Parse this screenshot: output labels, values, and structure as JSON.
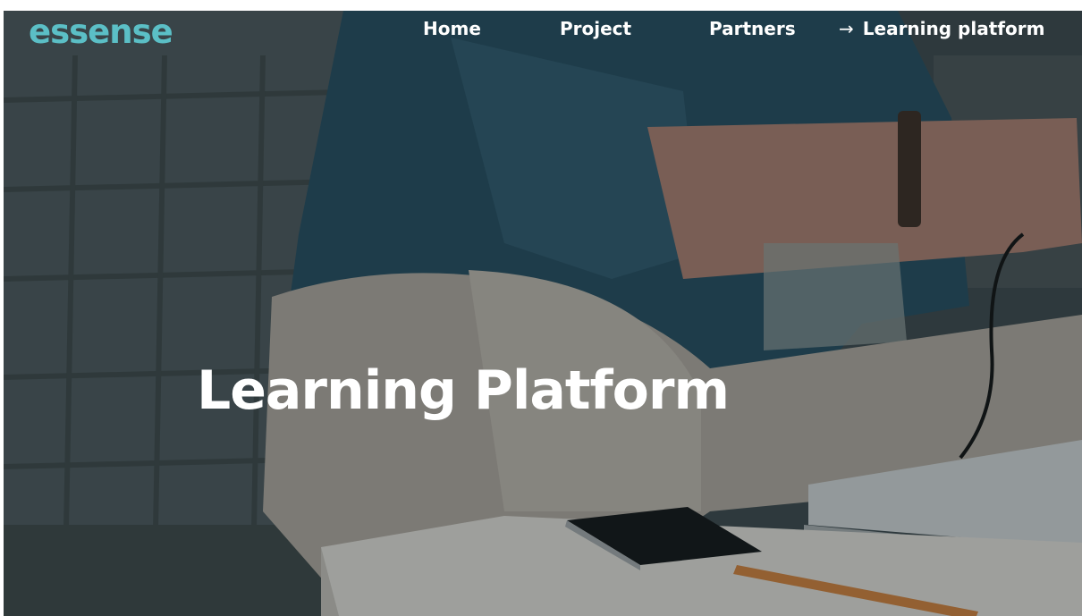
{
  "brand": {
    "logo_text": "essense",
    "accent_color": "#5bbfc6"
  },
  "nav": {
    "items": [
      {
        "label": "Home"
      },
      {
        "label": "Project"
      },
      {
        "label": "Partners"
      },
      {
        "label": "Learning platform",
        "active": true,
        "icon": "arrow-right-icon"
      }
    ],
    "active_arrow": "→"
  },
  "hero": {
    "title": "Learning Platform",
    "background_image": "person sitting on sofa using laptop"
  }
}
